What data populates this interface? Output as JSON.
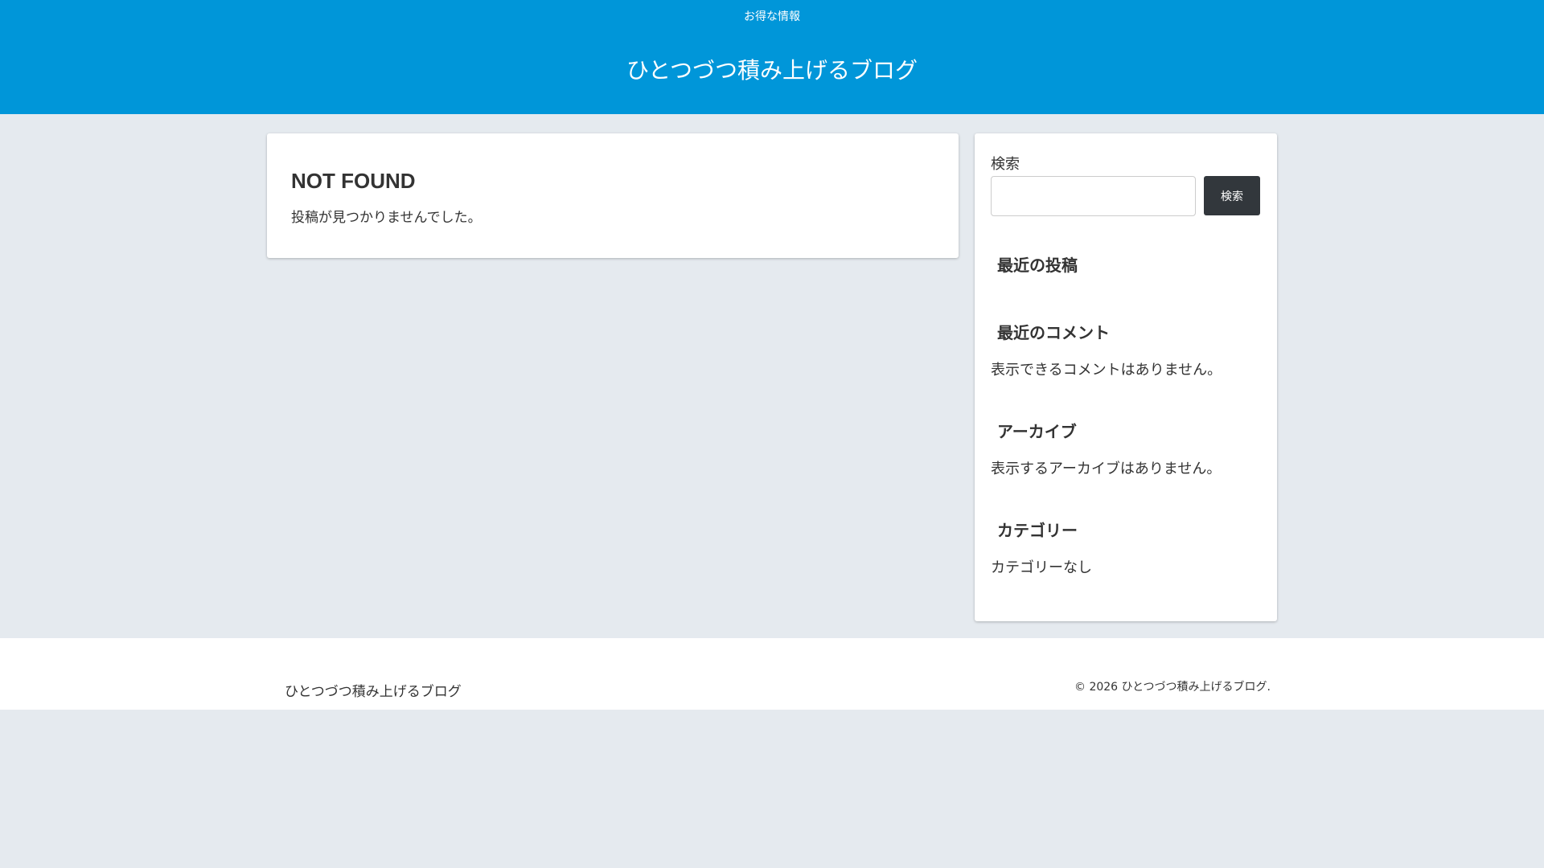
{
  "header": {
    "nav_link": "お得な情報",
    "site_title": "ひとつづつ積み上げるブログ"
  },
  "main": {
    "title": "NOT FOUND",
    "message": "投稿が見つかりませんでした。"
  },
  "sidebar": {
    "search_label": "検索",
    "search_value": "",
    "search_button": "検索",
    "recent_posts_title": "最近の投稿",
    "recent_comments_title": "最近のコメント",
    "recent_comments_text": "表示できるコメントはありません。",
    "archives_title": "アーカイブ",
    "archives_text": "表示するアーカイブはありません。",
    "categories_title": "カテゴリー",
    "categories_text": "カテゴリーなし"
  },
  "footer": {
    "site_title": "ひとつづつ積み上げるブログ",
    "copyright": "© 2026 ひとつづつ積み上げるブログ."
  }
}
